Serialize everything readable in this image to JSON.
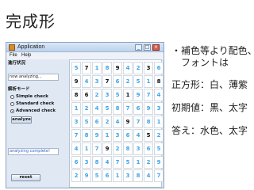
{
  "slide": {
    "title": "完成形",
    "notes": [
      "・補色等より配色、",
      "　フォントは",
      "正方形：白、薄紫",
      "初期値：黒、太字",
      "答え：水色、太字"
    ]
  },
  "window": {
    "title": "Application",
    "menu": [
      "File",
      "Help"
    ],
    "controls": [
      "_",
      "□",
      "×"
    ]
  },
  "panel": {
    "status_heading": "進行状況",
    "status_value": "now analyzing...",
    "mode_heading": "解析モード",
    "modes": [
      {
        "label": "Simple check",
        "selected": false
      },
      {
        "label": "Standard check",
        "selected": false
      },
      {
        "label": "Advanced check",
        "selected": true
      }
    ],
    "analyze_label": "analyze",
    "result_value": "analyzing complete!",
    "reset_label": "reset"
  },
  "sudoku": {
    "rows": [
      [
        "5",
        "7",
        "1",
        "8",
        "9",
        "4",
        "2",
        "3",
        "6"
      ],
      [
        "9",
        "4",
        "3",
        "7",
        "6",
        "2",
        "5",
        "1",
        "8"
      ],
      [
        "8",
        "6",
        "2",
        "3",
        "5",
        "1",
        "9",
        "7",
        "4"
      ],
      [
        "1",
        "2",
        "4",
        "5",
        "8",
        "7",
        "6",
        "9",
        "3"
      ],
      [
        "3",
        "5",
        "6",
        "2",
        "4",
        "9",
        "7",
        "8",
        "1"
      ],
      [
        "7",
        "8",
        "9",
        "1",
        "3",
        "6",
        "4",
        "5",
        "2"
      ],
      [
        "4",
        "1",
        "7",
        "9",
        "2",
        "8",
        "3",
        "6",
        "5"
      ],
      [
        "6",
        "3",
        "8",
        "4",
        "7",
        "5",
        "1",
        "2",
        "9"
      ],
      [
        "2",
        "9",
        "5",
        "6",
        "1",
        "3",
        "8",
        "4",
        "7"
      ]
    ],
    "given": [
      [
        0,
        1,
        0,
        0,
        1,
        0,
        0,
        1,
        0
      ],
      [
        1,
        0,
        0,
        1,
        0,
        0,
        0,
        0,
        1
      ],
      [
        1,
        1,
        0,
        0,
        0,
        1,
        0,
        0,
        0
      ],
      [
        0,
        0,
        0,
        0,
        0,
        0,
        0,
        0,
        0
      ],
      [
        0,
        0,
        0,
        0,
        0,
        1,
        0,
        0,
        0
      ],
      [
        0,
        0,
        0,
        0,
        0,
        0,
        0,
        1,
        0
      ],
      [
        0,
        0,
        0,
        1,
        0,
        0,
        0,
        0,
        0
      ],
      [
        0,
        0,
        0,
        0,
        0,
        0,
        0,
        0,
        0
      ],
      [
        0,
        0,
        0,
        0,
        0,
        0,
        0,
        0,
        0
      ]
    ],
    "colors": {
      "given": "#111111",
      "answer": "#42a6e6",
      "square": "#ffffff"
    }
  }
}
